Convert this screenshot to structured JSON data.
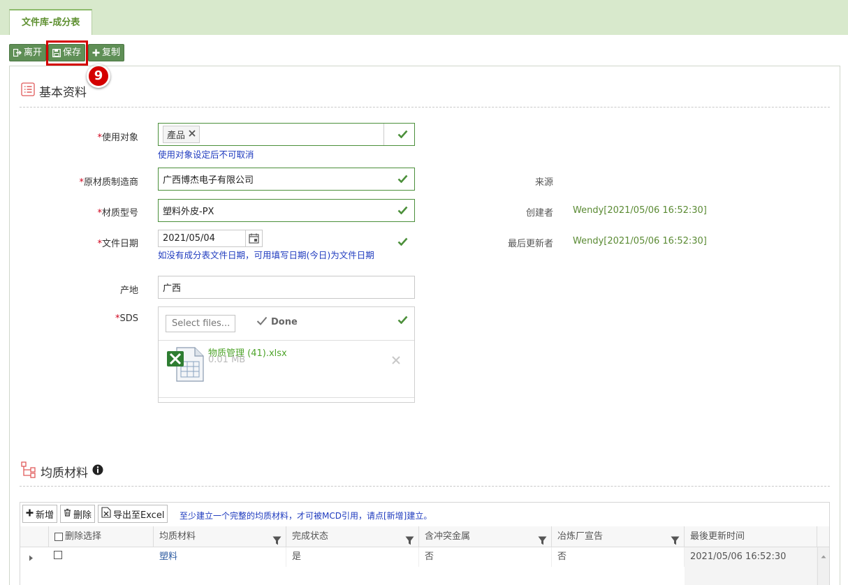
{
  "tab": {
    "label": "文件库-成分表"
  },
  "toolbar": {
    "leave_label": "离开",
    "save_label": "保存",
    "copy_label": "复制"
  },
  "annotation": {
    "step": "9"
  },
  "basic_info": {
    "title": "基本资料",
    "usage_target": {
      "label": "使用对象",
      "tag": "產品",
      "hint": "使用对象设定后不可取消"
    },
    "manufacturer": {
      "label": "原材质制造商",
      "value": "广西博杰电子有限公司"
    },
    "material_model": {
      "label": "材质型号",
      "value": "塑料外皮-PX"
    },
    "doc_date": {
      "label": "文件日期",
      "value": "2021/05/04",
      "hint": "如没有成分表文件日期，可用填写日期(今日)为文件日期"
    },
    "origin": {
      "label": "产地",
      "value": "广西"
    },
    "sds": {
      "label": "SDS",
      "select_label": "Select files...",
      "done_label": "Done",
      "file_name": "物质管理 (41).xlsx",
      "file_size": "0.01 MB"
    },
    "source": {
      "label": "来源",
      "value": ""
    },
    "creator": {
      "label": "创建者",
      "value": "Wendy[2021/05/06 16:52:30]"
    },
    "last_updater": {
      "label": "最后更新者",
      "value": "Wendy[2021/05/06 16:52:30]"
    }
  },
  "homogeneous": {
    "title": "均质材料",
    "add_label": "新增",
    "delete_label": "删除",
    "export_label": "导出至Excel",
    "hint": "至少建立一个完整的均质材料，才可被MCD引用，请点[新增]建立。",
    "columns": [
      "删除选择",
      "均质材料",
      "完成状态",
      "含冲突金属",
      "冶炼厂宣告",
      "最後更新时间"
    ],
    "rows": [
      {
        "material": "塑料",
        "status": "是",
        "conflict": "否",
        "smelter": "否",
        "updated": "2021/05/06 16:52:30"
      }
    ]
  },
  "colors": {
    "accent_green": "#5f8f56",
    "header_bg": "#d8e9cc",
    "required_red": "#d0021b",
    "hint_blue": "#1f3bbf",
    "highlight_red": "#d40000"
  }
}
